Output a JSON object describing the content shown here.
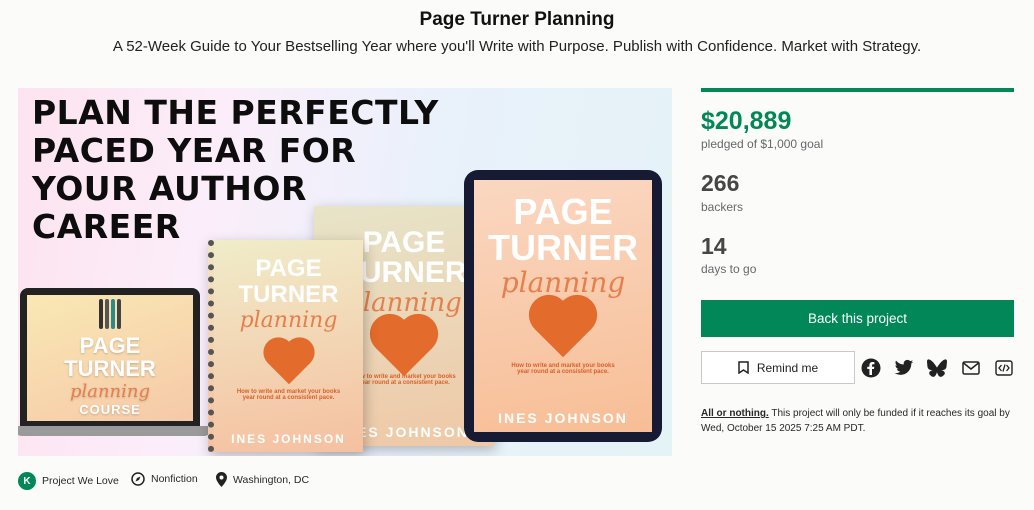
{
  "project": {
    "title": "Page Turner Planning",
    "subtitle": "A 52-Week Guide to Your Bestselling Year where you'll Write with Purpose. Publish with Confidence. Market with Strategy."
  },
  "hero": {
    "headline": "PLAN THE PERFECTLY\nPACED YEAR FOR\nYOUR AUTHOR\nCAREER",
    "laptop_cover": {
      "line1": "PAGE",
      "line2": "TURNER",
      "script": "planning",
      "line3": "COURSE"
    },
    "book_cover": {
      "line1": "PAGE",
      "line2": "TURNER",
      "script": "planning",
      "tagline": "How to write and market your books year round at a consistent pace.",
      "author": "INES JOHNSON"
    },
    "tablet_cover": {
      "line1": "PAGE",
      "line2": "TURNER",
      "script": "planning",
      "tagline": "How to write and market your books year round at a consistent pace.",
      "author": "INES JOHNSON"
    }
  },
  "stats": {
    "pledged": "$20,889",
    "goal_text": "pledged of $1,000 goal",
    "backers": "266",
    "backers_label": "backers",
    "days": "14",
    "days_label": "days to go",
    "funded_fraction": 1.0
  },
  "actions": {
    "back_label": "Back this project",
    "remind_label": "Remind me"
  },
  "share_icons": [
    "facebook-icon",
    "twitter-icon",
    "bluesky-icon",
    "email-icon",
    "embed-icon"
  ],
  "funding_note": {
    "link": "All or nothing.",
    "text": " This project will only be funded if it reaches its goal by Wed, October 15 2025 7:25 AM PDT."
  },
  "meta": {
    "badge": "Project We Love",
    "category": "Nonfiction",
    "location": "Washington, DC"
  },
  "colors": {
    "accent": "#028858",
    "text": "#282828",
    "muted": "#656969"
  }
}
